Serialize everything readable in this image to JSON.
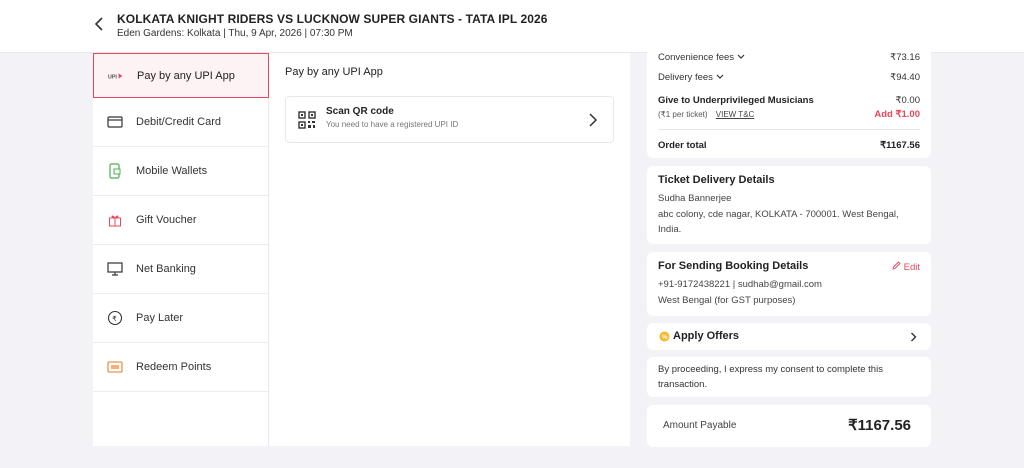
{
  "header": {
    "title": "KOLKATA KNIGHT RIDERS VS LUCKNOW SUPER GIANTS - TATA IPL 2026",
    "subtitle": "Eden Gardens: Kolkata | Thu, 9 Apr, 2026 | 07:30 PM"
  },
  "payment_menu": {
    "items": [
      {
        "label": "Pay by any UPI App",
        "icon": "upi-icon"
      },
      {
        "label": "Debit/Credit Card",
        "icon": "card-icon"
      },
      {
        "label": "Mobile Wallets",
        "icon": "wallet-icon"
      },
      {
        "label": "Gift Voucher",
        "icon": "gift-icon"
      },
      {
        "label": "Net Banking",
        "icon": "monitor-icon"
      },
      {
        "label": "Pay Later",
        "icon": "clock-icon"
      },
      {
        "label": "Redeem Points",
        "icon": "points-icon"
      }
    ]
  },
  "upi": {
    "title": "Pay by any UPI App",
    "scan_title": "Scan QR code",
    "scan_sub": "You need to have a registered UPI ID"
  },
  "summary": {
    "convenience_label": "Convenience fees",
    "convenience_value": "₹73.16",
    "delivery_label": "Delivery fees",
    "delivery_value": "₹94.40",
    "donate_label": "Give to Underprivileged Musicians",
    "donate_value": "₹0.00",
    "donate_note": "(₹1 per ticket)",
    "view_tc": "VIEW T&C",
    "add_label": "Add ₹1.00",
    "order_total_label": "Order total",
    "order_total_value": "₹1167.56"
  },
  "delivery": {
    "title": "Ticket Delivery Details",
    "name": "Sudha Bannerjee",
    "address_line1": "abc colony, cde nagar, KOLKATA - 700001. West Bengal,",
    "address_line2": "India."
  },
  "booking": {
    "title": "For Sending Booking Details",
    "edit": "Edit",
    "contact": "+91-9172438221 | sudhab@gmail.com",
    "state": "West Bengal (for GST purposes)"
  },
  "offers": {
    "label": "Apply Offers"
  },
  "consent": {
    "line1": "By proceeding, I express my consent to complete this",
    "line2": "transaction."
  },
  "payable": {
    "label": "Amount Payable",
    "value": "₹1167.56"
  },
  "colors": {
    "accent": "#e8465a",
    "offer": "#f5b82e"
  }
}
